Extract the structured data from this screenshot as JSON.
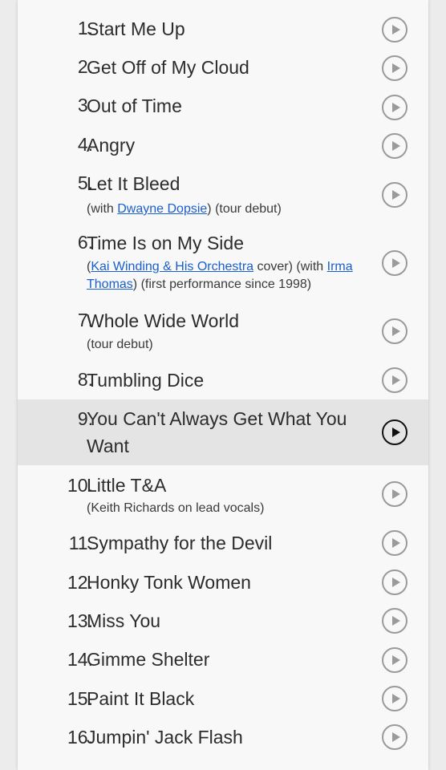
{
  "tracks": [
    {
      "num": "1.",
      "title": "Start Me Up"
    },
    {
      "num": "2.",
      "title": "Get Off of My Cloud"
    },
    {
      "num": "3.",
      "title": "Out of Time"
    },
    {
      "num": "4.",
      "title": "Angry"
    },
    {
      "num": "5.",
      "title": "Let It Bleed",
      "note": {
        "p1": "(with ",
        "link1": "Dwayne Dopsie",
        "p2": ") (tour debut)"
      }
    },
    {
      "num": "6.",
      "title": "Time Is on My Side",
      "note": {
        "p1": "(",
        "link1": "Kai Winding & His Orchestra",
        "p2": " cover) (with ",
        "link2": "Irma Thomas",
        "p3": ") (first performance since 1998)"
      }
    },
    {
      "num": "7.",
      "title": "Whole Wide World",
      "note": {
        "p1": "(tour debut)"
      }
    },
    {
      "num": "8.",
      "title": "Tumbling Dice"
    },
    {
      "num": "9.",
      "title": "You Can't Always Get What You Want"
    },
    {
      "num": "10.",
      "title": "Little T&A",
      "note": {
        "p1": "(Keith Richards on lead vocals)"
      }
    },
    {
      "num": "11.",
      "title": "Sympathy for the Devil"
    },
    {
      "num": "12.",
      "title": "Honky Tonk Women"
    },
    {
      "num": "13.",
      "title": "Miss You"
    },
    {
      "num": "14.",
      "title": "Gimme Shelter"
    },
    {
      "num": "15.",
      "title": "Paint It Black"
    },
    {
      "num": "16.",
      "title": "Jumpin' Jack Flash"
    }
  ],
  "colors": {
    "link": "#1a5fd0",
    "text": "#2c2c2c",
    "active_row": "#e4e4e4"
  },
  "icons": {
    "play": "play-circle-icon"
  }
}
